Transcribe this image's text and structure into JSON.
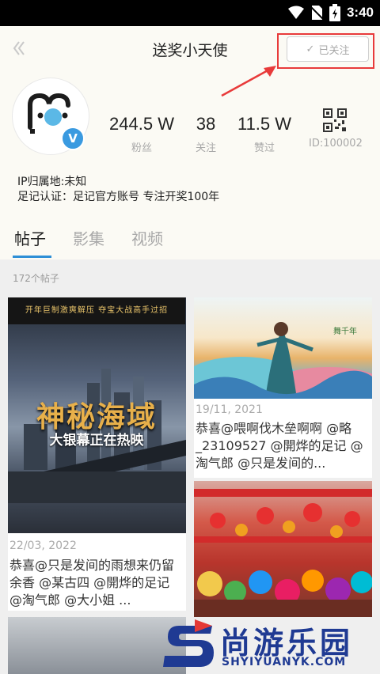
{
  "status_bar": {
    "time": "3:40"
  },
  "header": {
    "title": "送奖小天使",
    "follow_label": "已关注"
  },
  "profile": {
    "stats": [
      {
        "value": "244.5 W",
        "label": "粉丝"
      },
      {
        "value": "38",
        "label": "关注"
      },
      {
        "value": "11.5 W",
        "label": "赞过"
      }
    ],
    "id_label": "ID:100002",
    "ip_location": "IP归属地:未知",
    "certification": "足记认证：足记官方账号 专注开奖100年",
    "verify_badge": "V"
  },
  "tabs": [
    {
      "label": "帖子",
      "active": true
    },
    {
      "label": "影集",
      "active": false
    },
    {
      "label": "视频",
      "active": false
    }
  ],
  "post_count": "172个帖子",
  "posts": [
    {
      "banner": "开年巨制激爽解压 夺宝大战高手过招",
      "title": "神秘海域",
      "subtitle": "大银幕正在热映",
      "date": "22/03, 2022",
      "text": "恭喜@只是发间的雨想来仍留余香 @某古四 @開烨的足记 @淘气郎 @大小姐 ..."
    },
    {
      "logo_text": "舞千年",
      "date": "19/11, 2021",
      "text": "恭喜@喂啊伐木垒啊啊 @略_23109527 @開烨的足记 @淘气郎 @只是发间的..."
    }
  ],
  "watermark": {
    "text": "尚游乐园",
    "url": "SHYIYUANYK.COM"
  },
  "colors": {
    "accent": "#2e8fd6",
    "highlight": "#e83a3a",
    "verify": "#3a9ae0",
    "watermark": "#1f3a93"
  }
}
